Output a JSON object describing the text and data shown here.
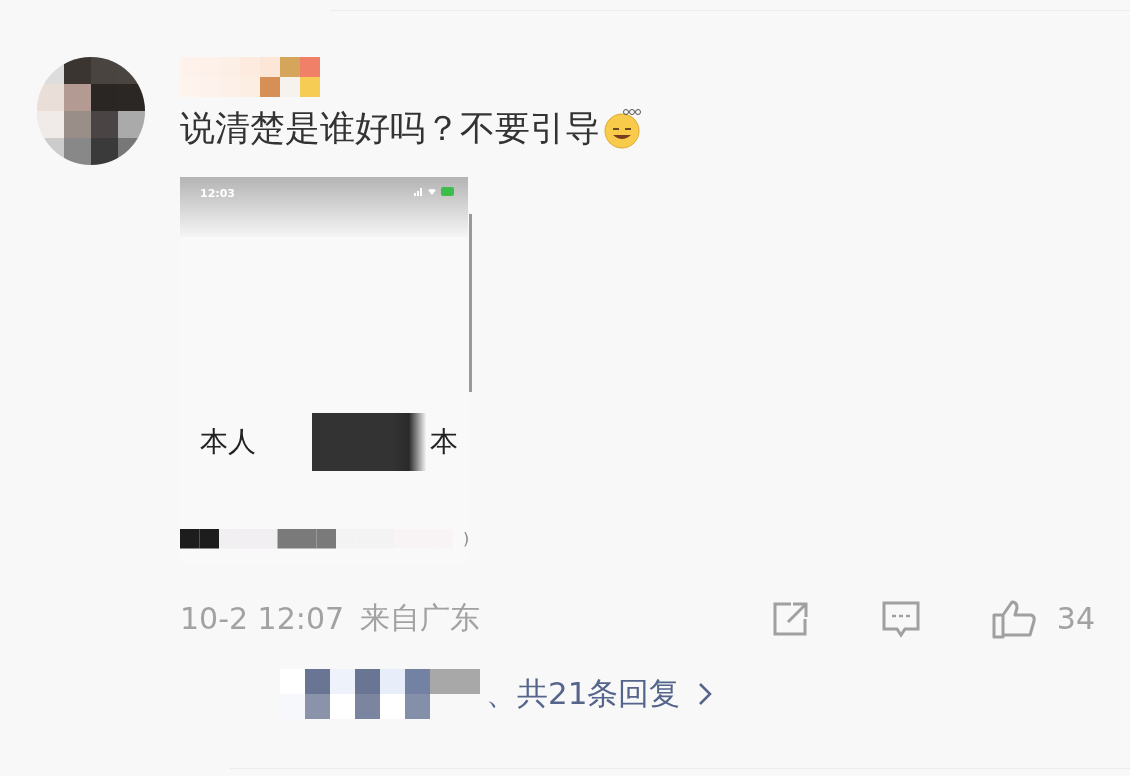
{
  "comment": {
    "text": "说清楚是谁好吗？不要引导",
    "screenshot": {
      "time": "12:03",
      "labels": [
        "本人",
        "本"
      ],
      "mark": ")"
    },
    "timestamp": "10-2 12:07",
    "location": "来自广东",
    "likes": "34",
    "replies": "、共21条回复"
  }
}
